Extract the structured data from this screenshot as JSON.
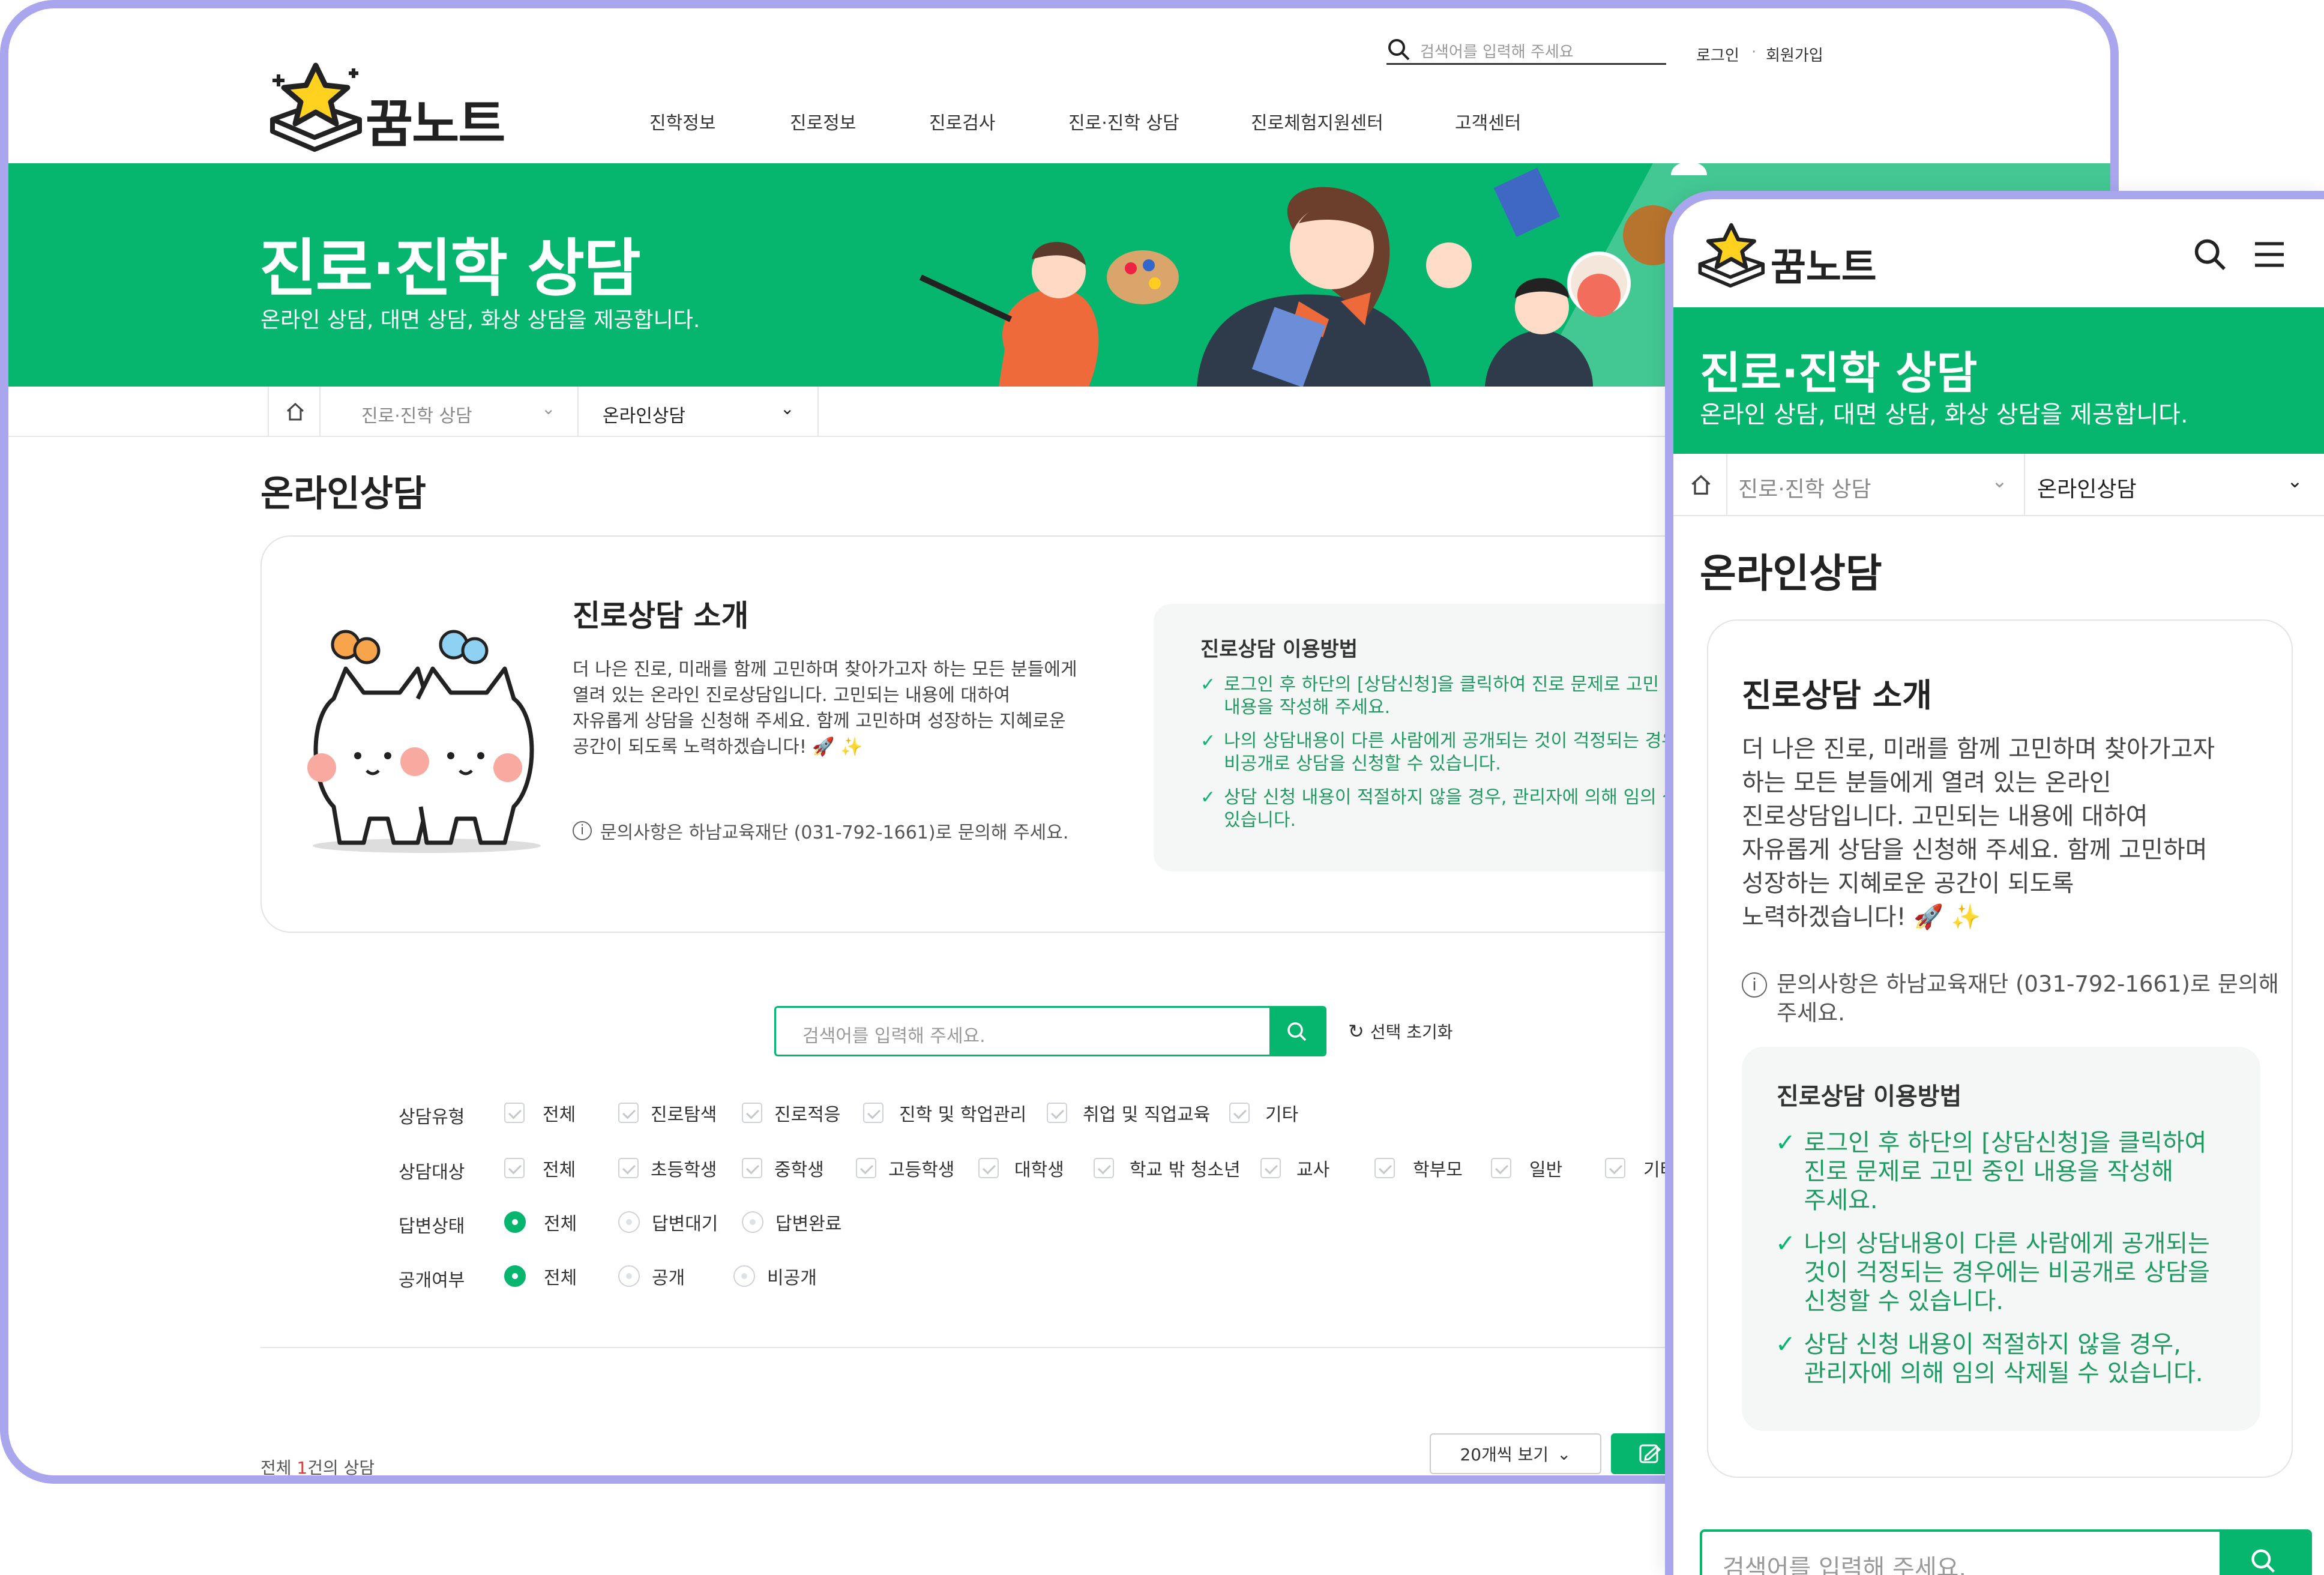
{
  "brand": {
    "name": "꿈노트"
  },
  "header": {
    "search_placeholder": "검색어를 입력해 주세요",
    "login": "로그인",
    "signup": "회원가입",
    "nav": [
      "진학정보",
      "진로정보",
      "진로검사",
      "진로·진학 상담",
      "진로체험지원센터",
      "고객센터"
    ]
  },
  "hero": {
    "title": "진로·진학 상담",
    "subtitle": "온라인 상담, 대면 상담, 화상 상담을 제공합니다."
  },
  "breadcrumb": {
    "level1": "진로·진학 상담",
    "level2": "온라인상담"
  },
  "page_title": "온라인상담",
  "intro": {
    "title": "진로상담 소개",
    "body_desktop": [
      "더 나은 진로, 미래를 함께 고민하며 찾아가고자 하는 모든 분들에게",
      "열려 있는 온라인 진로상담입니다. 고민되는 내용에 대하여",
      "자유롭게 상담을 신청해 주세요. 함께 고민하며 성장하는 지혜로운",
      "공간이 되도록 노력하겠습니다! 🚀 ✨"
    ],
    "body_mobile": [
      "더 나은 진로, 미래를 함께 고민하며 찾아가고자",
      "하는 모든 분들에게 열려 있는 온라인",
      "진로상담입니다. 고민되는 내용에 대하여",
      "자유롭게 상담을 신청해 주세요. 함께 고민하며",
      "성장하는 지혜로운 공간이 되도록",
      "노력하겠습니다! 🚀 ✨"
    ],
    "contact": "문의사항은 하남교육재단 (031-792-1661)로 문의해 주세요.",
    "contact_mobile": [
      "문의사항은 하남교육재단 (031-792-1661)로 문의해",
      "주세요."
    ],
    "howto_title": "진로상담 이용방법",
    "howto_desktop": [
      [
        "로그인 후 하단의 [상담신청]을 클릭하여 진로 문제로 고민 중",
        "내용을 작성해 주세요."
      ],
      [
        "나의 상담내용이 다른 사람에게 공개되는 것이 걱정되는 경우",
        "비공개로 상담을 신청할 수 있습니다."
      ],
      [
        "상담 신청 내용이 적절하지 않을 경우, 관리자에 의해 임의 삭",
        "있습니다."
      ]
    ],
    "howto_mobile": [
      [
        "로그인 후 하단의 [상담신청]을 클릭하여",
        "진로 문제로 고민 중인 내용을 작성해",
        "주세요."
      ],
      [
        "나의 상담내용이 다른 사람에게 공개되는",
        "것이 걱정되는 경우에는 비공개로 상담을",
        "신청할 수 있습니다."
      ],
      [
        "상담 신청 내용이 적절하지 않을 경우,",
        "관리자에 의해 임의 삭제될 수 있습니다."
      ]
    ]
  },
  "search": {
    "placeholder": "검색어를 입력해 주세요.",
    "reset": "선택 초기화"
  },
  "filters": {
    "type": {
      "label": "상담유형",
      "options": [
        "전체",
        "진로탐색",
        "진로적응",
        "진학 및 학업관리",
        "취업 및 직업교육",
        "기타"
      ]
    },
    "target": {
      "label": "상담대상",
      "options": [
        "전체",
        "초등학생",
        "중학생",
        "고등학생",
        "대학생",
        "학교 밖 청소년",
        "교사",
        "학부모",
        "일반",
        "기타"
      ]
    },
    "status": {
      "label": "답변상태",
      "options": [
        "전체",
        "답변대기",
        "답변완료"
      ],
      "selected": "전체"
    },
    "public": {
      "label": "공개여부",
      "options": [
        "전체",
        "공개",
        "비공개"
      ],
      "selected": "전체"
    }
  },
  "list": {
    "total_prefix": "전체 ",
    "total_count": "1",
    "total_suffix": "건의 상담",
    "page_size": "20개씩 보기"
  },
  "colors": {
    "accent": "#06b66f",
    "frame": "#a9a6ee"
  }
}
